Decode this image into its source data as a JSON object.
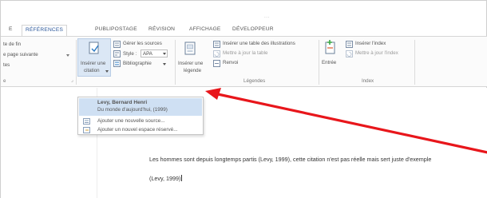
{
  "title_ghost": "...",
  "tabs": [
    {
      "label": "E"
    },
    {
      "label": "RÉFÉRENCES"
    },
    {
      "label": "PUBLIPOSTAGE"
    },
    {
      "label": "RÉVISION"
    },
    {
      "label": "AFFICHAGE"
    },
    {
      "label": "DÉVELOPPEUR"
    }
  ],
  "ribbon": {
    "footnotes": {
      "line1": "te de fin",
      "line2": "e page suivante",
      "line3": "tes",
      "group_label": "e"
    },
    "citations": {
      "insert_label_1": "Insérer une",
      "insert_label_2": "citation",
      "manage_sources": "Gérer les sources",
      "style_label": "Style :",
      "style_value": "APA",
      "bibliography": "Bibliographie"
    },
    "captions": {
      "insert_caption_1": "Insérer une",
      "insert_caption_2": "légende",
      "insert_table_illustrations": "Insérer une table des illustrations",
      "update_table": "Mettre à jour la table",
      "cross_reference": "Renvoi",
      "group_label": "Légendes"
    },
    "index": {
      "entry_label": "Entrée",
      "insert_index": "Insérer l'index",
      "update_index": "Mettre à jour l'index",
      "group_label": "Index"
    }
  },
  "dropdown": {
    "source_author": "Levy, Bernard Henri",
    "source_title": "Du monde d'aujourd'hui, (1999)",
    "add_new_source": "Ajouter une nouvelle source...",
    "add_placeholder": "Ajouter un nouvel espace réservé..."
  },
  "document": {
    "paragraph": "Les hommes sont depuis longtemps partis (Levy, 1999), cette citation n'est pas réelle mais sert juste d'exemple",
    "citation": "(Levy, 1999)"
  },
  "colors": {
    "accent": "#2b579a",
    "highlight": "#cfe0f3",
    "arrow": "#e8161b"
  }
}
